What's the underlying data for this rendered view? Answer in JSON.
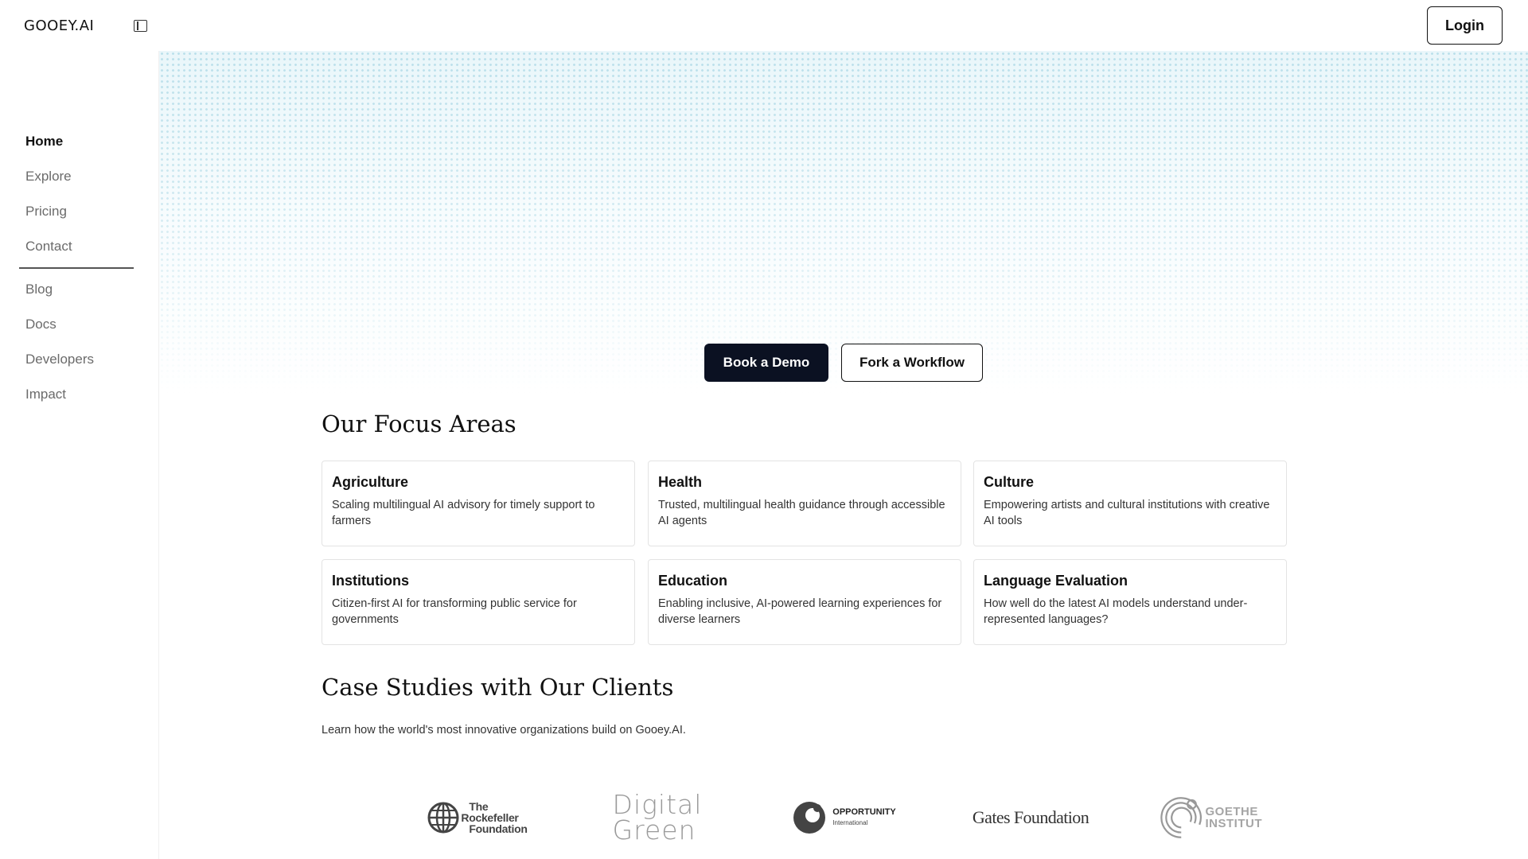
{
  "header": {
    "brand": "GOOEY.AI",
    "login_label": "Login"
  },
  "sidebar": {
    "items": [
      {
        "label": "Home",
        "active": true
      },
      {
        "label": "Explore"
      },
      {
        "label": "Pricing"
      },
      {
        "label": "Contact"
      },
      {
        "label": "Blog"
      },
      {
        "label": "Docs"
      },
      {
        "label": "Developers"
      },
      {
        "label": "Impact"
      }
    ]
  },
  "hero": {
    "primary_cta": "Book a Demo",
    "secondary_cta": "Fork a Workflow"
  },
  "focus": {
    "title": "Our Focus Areas",
    "cards": [
      {
        "title": "Agriculture",
        "desc": "Scaling multilingual AI advisory for timely support to farmers"
      },
      {
        "title": "Health",
        "desc": "Trusted, multilingual health guidance through accessible AI agents"
      },
      {
        "title": "Culture",
        "desc": "Empowering artists and cultural institutions with creative AI tools"
      },
      {
        "title": "Institutions",
        "desc": "Citizen-first AI for transforming public service for governments"
      },
      {
        "title": "Education",
        "desc": "Enabling inclusive, AI-powered learning experiences for diverse learners"
      },
      {
        "title": "Language Evaluation",
        "desc": "How well do the latest AI models understand under-represented languages?"
      }
    ]
  },
  "case_studies": {
    "title": "Case Studies with Our Clients",
    "subtitle": "Learn how the world's most innovative organizations build on Gooey.AI.",
    "logos": [
      {
        "name": "rockefeller",
        "lines": [
          "The",
          "Rockefeller",
          "Foundation"
        ]
      },
      {
        "name": "digital-green",
        "lines": [
          "Digital",
          "Green"
        ]
      },
      {
        "name": "opportunity",
        "lines": [
          "OPPORTUNITY",
          "International"
        ]
      },
      {
        "name": "gates",
        "lines": [
          "Gates Foundation"
        ]
      },
      {
        "name": "goethe",
        "lines": [
          "GOETHE",
          "INSTITUT"
        ]
      }
    ]
  },
  "colors": {
    "primary_button": "#0b1122",
    "hero_dots": "#96cede"
  }
}
